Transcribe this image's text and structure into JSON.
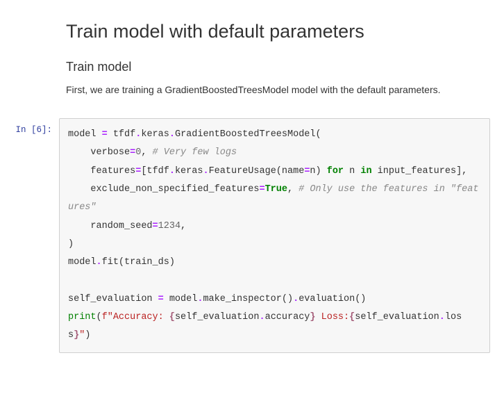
{
  "heading": "Train model with default parameters",
  "subheading": "Train model",
  "paragraph": "First, we are training a GradientBoostedTreesModel model with the default parameters.",
  "cell": {
    "prompt": "In [6]:",
    "code": {
      "l1a": "model ",
      "l1b": "=",
      "l1c": " tfdf",
      "l1d": ".",
      "l1e": "keras",
      "l1f": ".",
      "l1g": "GradientBoostedTreesModel(",
      "l2a": "    verbose",
      "l2b": "=",
      "l2c": "0",
      "l2d": ", ",
      "l2e": "# Very few logs",
      "l3a": "    features",
      "l3b": "=",
      "l3c": "[tfdf",
      "l3d": ".",
      "l3e": "keras",
      "l3f": ".",
      "l3g": "FeatureUsage(name",
      "l3h": "=",
      "l3i": "n) ",
      "l3j": "for",
      "l3k": " n ",
      "l3l": "in",
      "l3m": " input_features],",
      "l4a": "    exclude_non_specified_features",
      "l4b": "=",
      "l4c": "True",
      "l4d": ", ",
      "l4e": "# Only use the features in \"features\"",
      "l5a": "    random_seed",
      "l5b": "=",
      "l5c": "1234",
      "l5d": ",",
      "l6": ")",
      "l7a": "model",
      "l7b": ".",
      "l7c": "fit(train_ds)",
      "l8": "",
      "l9a": "self_evaluation ",
      "l9b": "=",
      "l9c": " model",
      "l9d": ".",
      "l9e": "make_inspector()",
      "l9f": ".",
      "l9g": "evaluation()",
      "l10a": "print",
      "l10b": "(",
      "l10c": "f\"",
      "l10d": "Accuracy: ",
      "l10e": "{",
      "l10f": "self_evaluation",
      "l10g": ".",
      "l10h": "accuracy",
      "l10i": "}",
      "l10j": " Loss:",
      "l10k": "{",
      "l10l": "self_evaluation",
      "l10m": ".",
      "l10n": "loss",
      "l10o": "}",
      "l10p": "\"",
      "l10q": ")"
    }
  }
}
